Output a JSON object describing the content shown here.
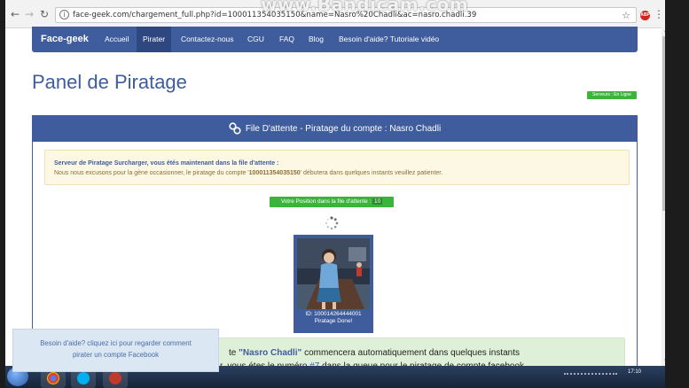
{
  "watermark": "www.Bandicam.com",
  "browser": {
    "url": "face-geek.com/chargement_full.php?id=100011354035150&name=Nasro%20Chadli&ac=nasro.chadli.39",
    "back_icon": "back-arrow-icon",
    "forward_icon": "forward-arrow-icon",
    "reload_icon": "reload-icon",
    "star_icon": "bookmark-star-icon",
    "ext_label": "ABP",
    "menu_icon": "kebab-menu-icon"
  },
  "navbar": {
    "brand": "Face-geek",
    "items": [
      {
        "label": "Accueil"
      },
      {
        "label": "Pirater"
      },
      {
        "label": "Contactez-nous"
      },
      {
        "label": "CGU"
      },
      {
        "label": "FAQ"
      },
      {
        "label": "Blog"
      },
      {
        "label": "Besoin d'aide? Tutoriale vidéo"
      }
    ],
    "active_index": 1
  },
  "page": {
    "title": "Panel de Piratage",
    "status_badge": "Serveurs : En Ligne"
  },
  "panel": {
    "heading": "File D'attente - Piratage du compte : Nasro Chadli",
    "alert_title": "Serveur de Piratage Surcharger, vous étés maintenant dans la file d'attente :",
    "alert_body_prefix": "Nous nous excusons pour la gène occasionner, le piratage du compte '",
    "alert_body_id": "100011354035150",
    "alert_body_suffix": "' débutera dans quelques instants veuillez patienter.",
    "position_label": "Votre Position dans la file d'attente : ",
    "position_value": "10",
    "profile_id": "ID: 100014264444001",
    "profile_status": "Piratage Done!"
  },
  "success": {
    "line1_prefix": "te ",
    "line1_name": "\"Nasro Chadli\"",
    "line1_suffix": " commencera automatiquement dans quelques instants",
    "line2_prefix": "r, vous étes le numéro ",
    "line2_number": "#7",
    "line2_suffix": " dans la queue pour le piratage de compte facebook"
  },
  "help_popup": {
    "line1": "Besoin d'aide? cliquez ici pour regarder comment",
    "line2": "pirater un compte Facebook"
  },
  "taskbar": {
    "clock": "17:10"
  },
  "colors": {
    "brand_blue": "#3f5c9c",
    "success_green": "#3cb43c",
    "alert_bg": "#fcf8e3",
    "success_bg": "#dff0d8"
  }
}
